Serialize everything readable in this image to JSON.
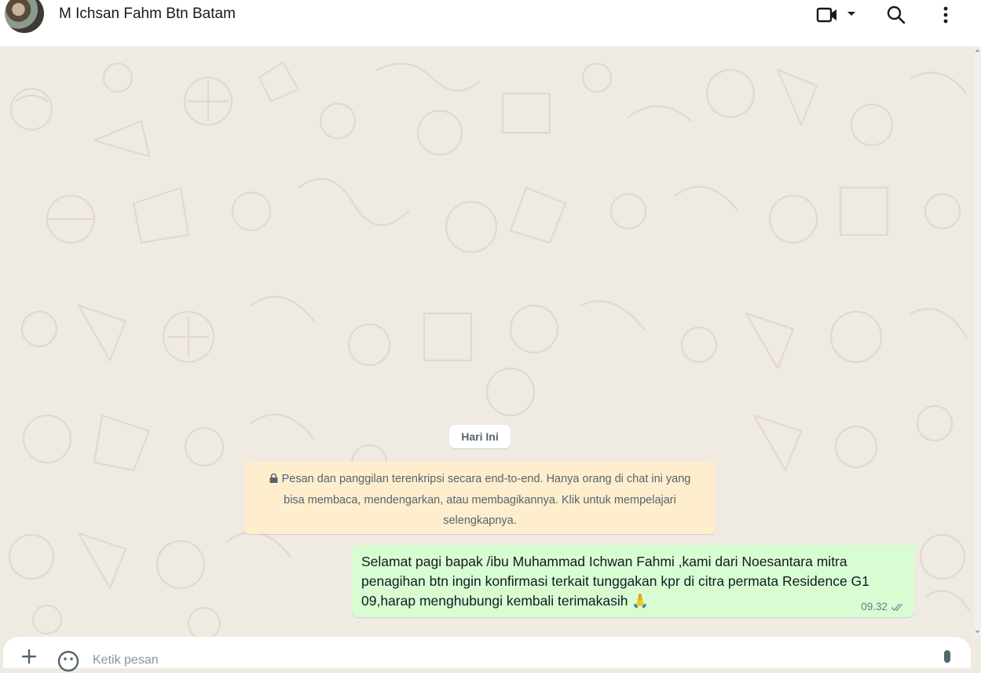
{
  "header": {
    "contact_name": "M Ichsan Fahm Btn Batam",
    "icons": [
      "avatar",
      "video-call-icon",
      "chevron-down-icon",
      "search-icon",
      "kebab-menu-icon"
    ]
  },
  "chat": {
    "date_chip": "Hari Ini",
    "encryption_notice": "Pesan dan panggilan terenkripsi secara end-to-end. Hanya orang di chat ini yang bisa membaca, mendengarkan, atau membagikannya. Klik untuk mempelajari selengkapnya.",
    "messages": [
      {
        "direction": "outgoing",
        "text": "Selamat pagi bapak /ibu Muhammad Ichwan Fahmi ,kami dari Noesantara mitra penagihan btn ingin konfirmasi terkait tunggakan kpr di citra permata Residence G1 09,harap menghubungi kembali terimakasih 🙏",
        "time": "09.32",
        "status": "delivered"
      }
    ]
  },
  "composer": {
    "placeholder": "Ketik pesan"
  },
  "colors": {
    "chat_bg": "#efeae2",
    "outgoing_bubble": "#d9fdd3",
    "notice_bg": "#ffeecd",
    "header_bg": "#ffffff"
  }
}
